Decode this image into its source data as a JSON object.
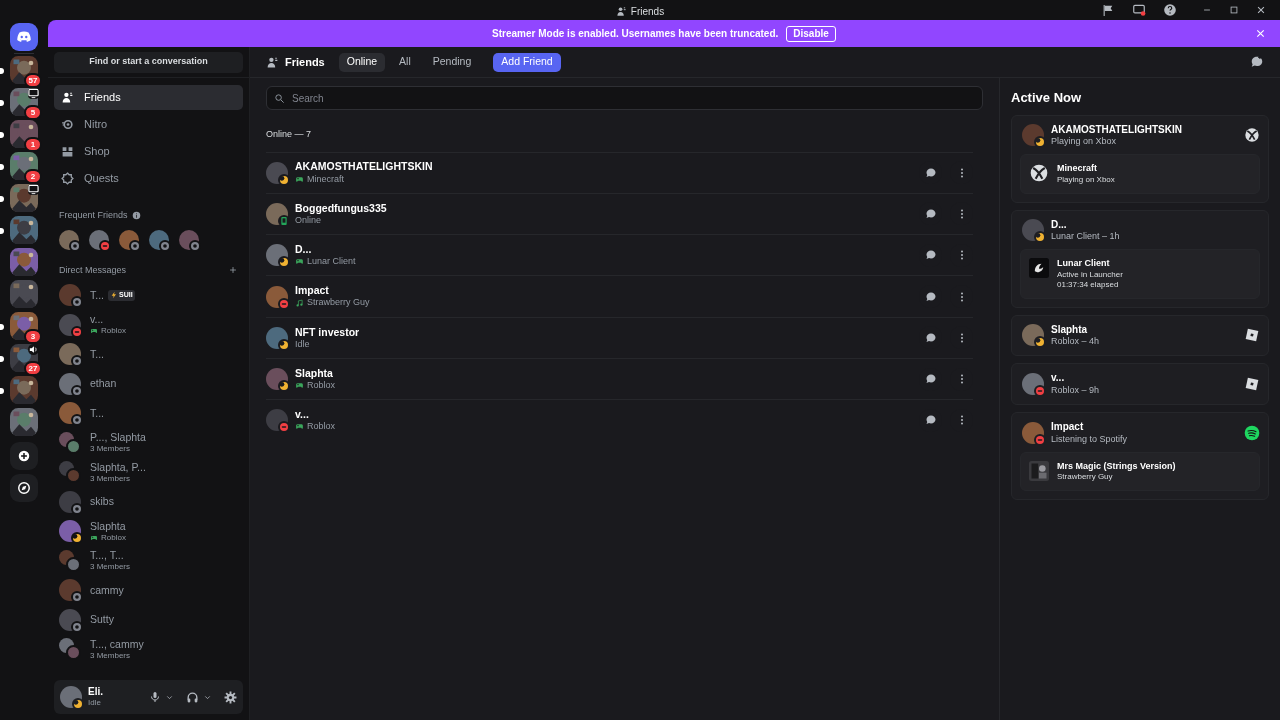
{
  "window": {
    "title": "Friends"
  },
  "banner": {
    "text": "Streamer Mode is enabled. Usernames have been truncated.",
    "button": "Disable"
  },
  "servers": [
    {
      "badge": "57",
      "unread": true,
      "screen_share": false,
      "in_voice": false
    },
    {
      "badge": "5",
      "unread": true,
      "screen_share": true,
      "in_voice": false
    },
    {
      "badge": "1",
      "unread": true,
      "screen_share": false,
      "in_voice": false
    },
    {
      "badge": "2",
      "unread": true,
      "screen_share": false,
      "in_voice": false
    },
    {
      "unread": true,
      "screen_share": true,
      "in_voice": false
    },
    {
      "unread": true,
      "screen_share": false,
      "in_voice": false
    },
    {
      "unread": false,
      "screen_share": false,
      "in_voice": false
    },
    {
      "unread": false,
      "screen_share": false,
      "in_voice": false
    },
    {
      "badge": "3",
      "unread": true,
      "screen_share": false,
      "in_voice": false
    },
    {
      "badge": "27",
      "unread": true,
      "screen_share": false,
      "in_voice": true
    },
    {
      "unread": true,
      "screen_share": false,
      "in_voice": false
    },
    {
      "unread": false,
      "screen_share": false,
      "in_voice": false
    }
  ],
  "sidebar": {
    "search": "Find or start a conversation",
    "nav": [
      {
        "label": "Friends",
        "selected": true
      },
      {
        "label": "Nitro",
        "selected": false
      },
      {
        "label": "Shop",
        "selected": false
      },
      {
        "label": "Quests",
        "selected": false
      }
    ],
    "frequent_friends": {
      "title": "Frequent Friends",
      "friends": [
        {
          "color": "#80848e"
        },
        {
          "color": "#f23f43"
        },
        {
          "color": "#80848e"
        },
        {
          "color": "#80848e"
        },
        {
          "color": "#80848e"
        }
      ]
    },
    "direct_messages": {
      "title": "Direct Messages",
      "items": [
        {
          "kind": "user",
          "name": "T...",
          "tag": "SUII",
          "color": "#80848e"
        },
        {
          "kind": "user",
          "name": "v...",
          "activity": "Roblox",
          "color": "#f23f43"
        },
        {
          "kind": "user",
          "name": "T...",
          "color": "#80848e"
        },
        {
          "kind": "user",
          "name": "ethan",
          "color": "#80848e"
        },
        {
          "kind": "user",
          "name": "T...",
          "color": "#80848e"
        },
        {
          "kind": "group",
          "name": "P..., Slaphta",
          "members": "3 Members"
        },
        {
          "kind": "group",
          "name": "Slaphta, P...",
          "members": "3 Members"
        },
        {
          "kind": "user",
          "name": "skibs",
          "color": "#80848e"
        },
        {
          "kind": "user",
          "name": "Slaphta",
          "activity": "Roblox",
          "color": "#f0b232"
        },
        {
          "kind": "group",
          "name": "T..., T...",
          "members": "3 Members"
        },
        {
          "kind": "user",
          "name": "cammy",
          "color": "#80848e"
        },
        {
          "kind": "user",
          "name": "Sutty",
          "color": "#80848e"
        },
        {
          "kind": "group",
          "name": "T..., cammy",
          "members": "3 Members"
        }
      ]
    }
  },
  "user_panel": {
    "name": "Eli.",
    "status_text": "Idle",
    "color": "#f0b232"
  },
  "header": {
    "title": "Friends",
    "tabs": [
      {
        "label": "Online",
        "kind": "tab",
        "selected": true
      },
      {
        "label": "All",
        "kind": "tab",
        "selected": false
      },
      {
        "label": "Pending",
        "kind": "tab",
        "selected": false
      },
      {
        "label": "Add Friend",
        "kind": "button",
        "selected": false
      }
    ]
  },
  "search": {
    "placeholder": "Search"
  },
  "section_title": "Online — 7",
  "friends": [
    {
      "name": "AKAMOSTHATELIGHTSKIN",
      "activity": "Minecraft",
      "kind": "game",
      "color": "#f0b232"
    },
    {
      "name": "Boggedfungus335",
      "activity": "Online",
      "kind": "plain",
      "color": "#23a55a"
    },
    {
      "name": "D...",
      "activity": "Lunar Client",
      "kind": "game",
      "color": "#f0b232"
    },
    {
      "name": "Impact",
      "activity": "Strawberry Guy",
      "kind": "music",
      "color": "#f23f43"
    },
    {
      "name": "NFT investor",
      "activity": "Idle",
      "kind": "plain",
      "color": "#f0b232"
    },
    {
      "name": "Slaphta",
      "activity": "Roblox",
      "kind": "game",
      "color": "#f0b232"
    },
    {
      "name": "v...",
      "activity": "Roblox",
      "kind": "game",
      "color": "#f23f43"
    }
  ],
  "active_now": {
    "title": "Active Now",
    "cards": [
      {
        "kind": "xbox",
        "name": "AKAMOSTHATELIGHTSKIN",
        "subtitle": "Playing on Xbox",
        "color": "#f0b232",
        "detail": {
          "title": "Minecraft",
          "lines": [
            "Playing on Xbox"
          ]
        }
      },
      {
        "kind": "launcher",
        "name": "D...",
        "subtitle": "Lunar Client – 1h",
        "color": "#f0b232",
        "detail": {
          "title": "Lunar Client",
          "lines": [
            "Active in Launcher",
            "01:37:34 elapsed"
          ]
        }
      },
      {
        "kind": "roblox",
        "name": "Slaphta",
        "subtitle": "Roblox – 4h",
        "color": "#f0b232"
      },
      {
        "kind": "roblox",
        "name": "v...",
        "subtitle": "Roblox – 9h",
        "color": "#f23f43"
      },
      {
        "kind": "spotify",
        "name": "Impact",
        "subtitle": "Listening to Spotify",
        "color": "#f23f43",
        "detail": {
          "title": "Mrs Magic (Strings Version)",
          "lines": [
            "Strawberry Guy"
          ]
        }
      }
    ]
  }
}
